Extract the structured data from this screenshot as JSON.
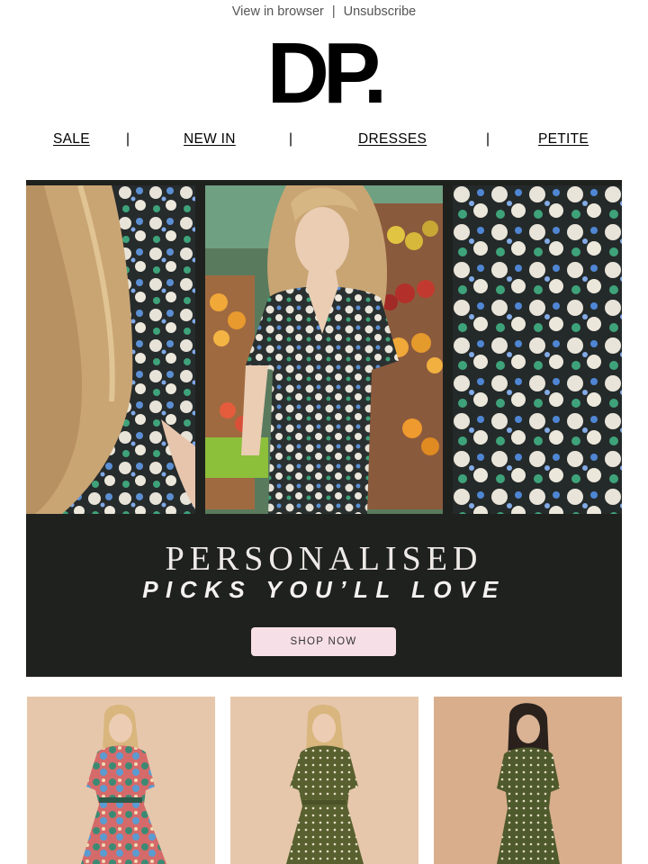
{
  "topbar": {
    "view_in_browser": "View in browser",
    "separator": "|",
    "unsubscribe": "Unsubscribe"
  },
  "logo": {
    "text": "DP."
  },
  "nav": {
    "items": [
      {
        "label": "SALE"
      },
      {
        "label": "NEW IN"
      },
      {
        "label": "DRESSES"
      },
      {
        "label": "PETITE"
      }
    ],
    "separator": "|"
  },
  "hero": {
    "headline_1": "PERSONALISED",
    "headline_2": "PICKS YOU’LL LOVE",
    "cta_label": "SHOP NOW",
    "colors": {
      "background": "#1f211e",
      "cta": "#f7dfe7"
    }
  },
  "products": [
    {
      "image": "floral-shirt-dress-photo"
    },
    {
      "image": "green-polka-dot-shirt-dress-photo"
    },
    {
      "image": "green-polka-dot-midi-dress-photo"
    }
  ]
}
